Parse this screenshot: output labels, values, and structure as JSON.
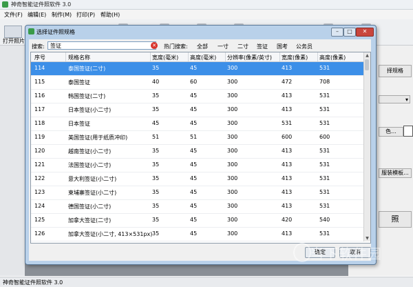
{
  "app": {
    "title": "神奇智能证件照软件 3.0",
    "status": "神奇智能证件照软件 3.0",
    "menu": [
      "文件(F)",
      "编辑(E)",
      "制作(M)",
      "打印(P)",
      "帮助(H)"
    ],
    "toolbar_open_label": "打开照片"
  },
  "right_panel": {
    "btn_spec": "择规格",
    "btn_color": "色...",
    "btn_template": "服装模板...",
    "btn_photo": "照"
  },
  "dialog": {
    "title": "选择证件照规格",
    "search_label": "搜索:",
    "search_value": "签证",
    "hot_label": "热门搜索:",
    "hot_items": [
      "全部",
      "一寸",
      "二寸",
      "签证",
      "国考",
      "公务员"
    ],
    "columns": [
      "序号",
      "规格名称",
      "宽度(毫米)",
      "高度(毫米)",
      "分辨率(像素/英寸)",
      "宽度(像素)",
      "高度(像素)"
    ],
    "rows": [
      [
        "114",
        "泰国签证(二寸)",
        "35",
        "45",
        "300",
        "413",
        "531"
      ],
      [
        "115",
        "泰国签证",
        "40",
        "60",
        "300",
        "472",
        "708"
      ],
      [
        "116",
        "韩国签证(二寸)",
        "35",
        "45",
        "300",
        "413",
        "531"
      ],
      [
        "117",
        "日本签证(小二寸)",
        "35",
        "45",
        "300",
        "413",
        "531"
      ],
      [
        "118",
        "日本签证",
        "45",
        "45",
        "300",
        "531",
        "531"
      ],
      [
        "119",
        "美国签证(用于纸质冲印)",
        "51",
        "51",
        "300",
        "600",
        "600"
      ],
      [
        "120",
        "越南签证(小二寸)",
        "35",
        "45",
        "300",
        "413",
        "531"
      ],
      [
        "121",
        "法国签证(小二寸)",
        "35",
        "45",
        "300",
        "413",
        "531"
      ],
      [
        "122",
        "意大利签证(小二寸)",
        "35",
        "45",
        "300",
        "413",
        "531"
      ],
      [
        "123",
        "柬埔寨签证(小二寸)",
        "35",
        "45",
        "300",
        "413",
        "531"
      ],
      [
        "124",
        "德国签证(小二寸)",
        "35",
        "45",
        "300",
        "413",
        "531"
      ],
      [
        "125",
        "加拿大签证(二寸)",
        "35",
        "45",
        "300",
        "420",
        "540"
      ],
      [
        "126",
        "加拿大签证(小二寸, 413×531px)",
        "35",
        "45",
        "300",
        "413",
        "531"
      ]
    ],
    "ok_label": "确定",
    "cancel_label": "取消"
  },
  "watermark": "当下软件园",
  "colors": {
    "selection": "#3c8fe8",
    "dialog_frame": "#b9d1ea",
    "close_button": "#c9463d"
  }
}
